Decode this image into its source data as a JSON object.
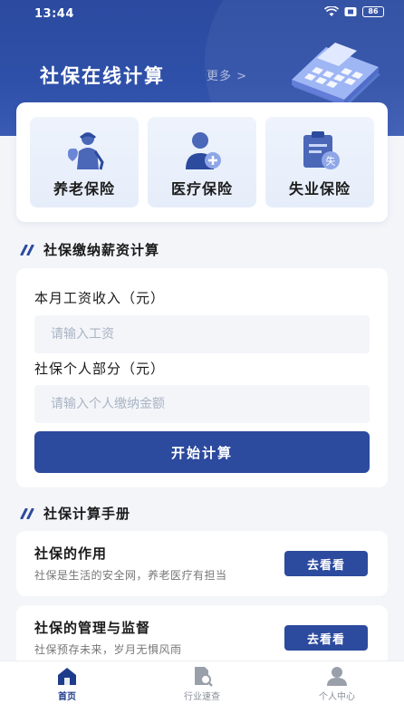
{
  "status_bar": {
    "time": "13:44",
    "battery": "86"
  },
  "header": {
    "title": "社保在线计算",
    "more": "更多 >"
  },
  "insurance": [
    {
      "label": "养老保险",
      "icon": "elderly-care-icon"
    },
    {
      "label": "医疗保险",
      "icon": "medical-person-icon"
    },
    {
      "label": "失业保险",
      "icon": "unemployment-clipboard-icon",
      "badge": "失"
    }
  ],
  "calculator": {
    "section_title": "社保缴纳薪资计算",
    "salary_label": "本月工资收入（元）",
    "salary_placeholder": "请输入工资",
    "personal_label": "社保个人部分（元）",
    "personal_placeholder": "请输入个人缴纳金额",
    "start_button": "开始计算"
  },
  "handbook": {
    "section_title": "社保计算手册",
    "items": [
      {
        "title": "社保的作用",
        "desc": "社保是生活的安全网，养老医疗有担当",
        "button": "去看看"
      },
      {
        "title": "社保的管理与监督",
        "desc": "社保预存未来，岁月无惧风雨",
        "button": "去看看"
      }
    ]
  },
  "tabs": [
    {
      "label": "首页",
      "icon": "home-icon",
      "active": true
    },
    {
      "label": "行业速查",
      "icon": "document-search-icon",
      "active": false
    },
    {
      "label": "个人中心",
      "icon": "user-icon",
      "active": false
    }
  ],
  "colors": {
    "primary": "#2c4a9e",
    "header": "#2f50a8",
    "background": "#f3f5f9"
  }
}
